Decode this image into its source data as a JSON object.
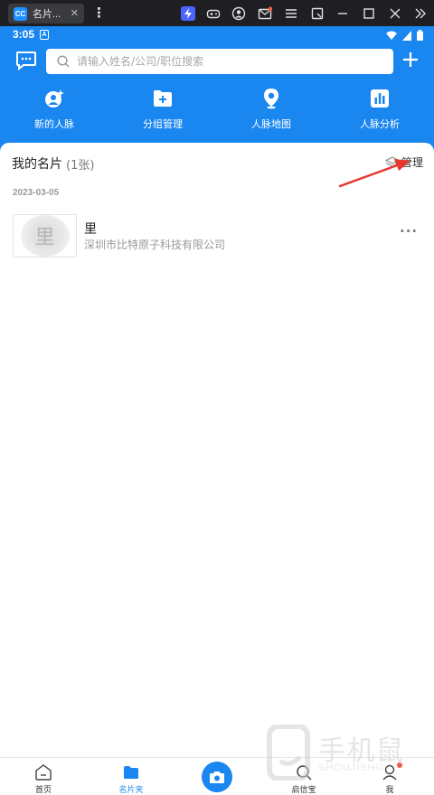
{
  "emulator": {
    "tab_logo": "CC",
    "tab_title": "名片...",
    "tab_close": "✕"
  },
  "status_bar": {
    "time": "3:05",
    "notif_letter": "A"
  },
  "header": {
    "search_placeholder": "请输入姓名/公司/职位搜索",
    "quick_actions": [
      {
        "label": "新的人脉",
        "icon": "new-contact-icon"
      },
      {
        "label": "分组管理",
        "icon": "group-folder-icon"
      },
      {
        "label": "人脉地图",
        "icon": "map-pin-icon"
      },
      {
        "label": "人脉分析",
        "icon": "bar-chart-icon"
      }
    ]
  },
  "cards": {
    "title": "我的名片",
    "count": "(1张)",
    "manage_label": "管理",
    "groups": [
      {
        "date": "2023-03-05",
        "items": [
          {
            "thumb_char": "里",
            "name": "里",
            "company": "深圳市比特原子科技有限公司",
            "more": "···"
          }
        ]
      }
    ]
  },
  "bottom_nav": {
    "items": [
      {
        "label": "首页",
        "active": false
      },
      {
        "label": "名片夹",
        "active": true
      },
      {
        "label": "启信宝",
        "active": false
      },
      {
        "label": "我",
        "active": false
      }
    ]
  },
  "colors": {
    "brand_blue": "#1a87f0",
    "annotation_red": "#e8372c",
    "badge_red": "#f05a4b"
  },
  "watermark": {
    "text": "手机鼠",
    "sub": "SHOUJISHU"
  }
}
